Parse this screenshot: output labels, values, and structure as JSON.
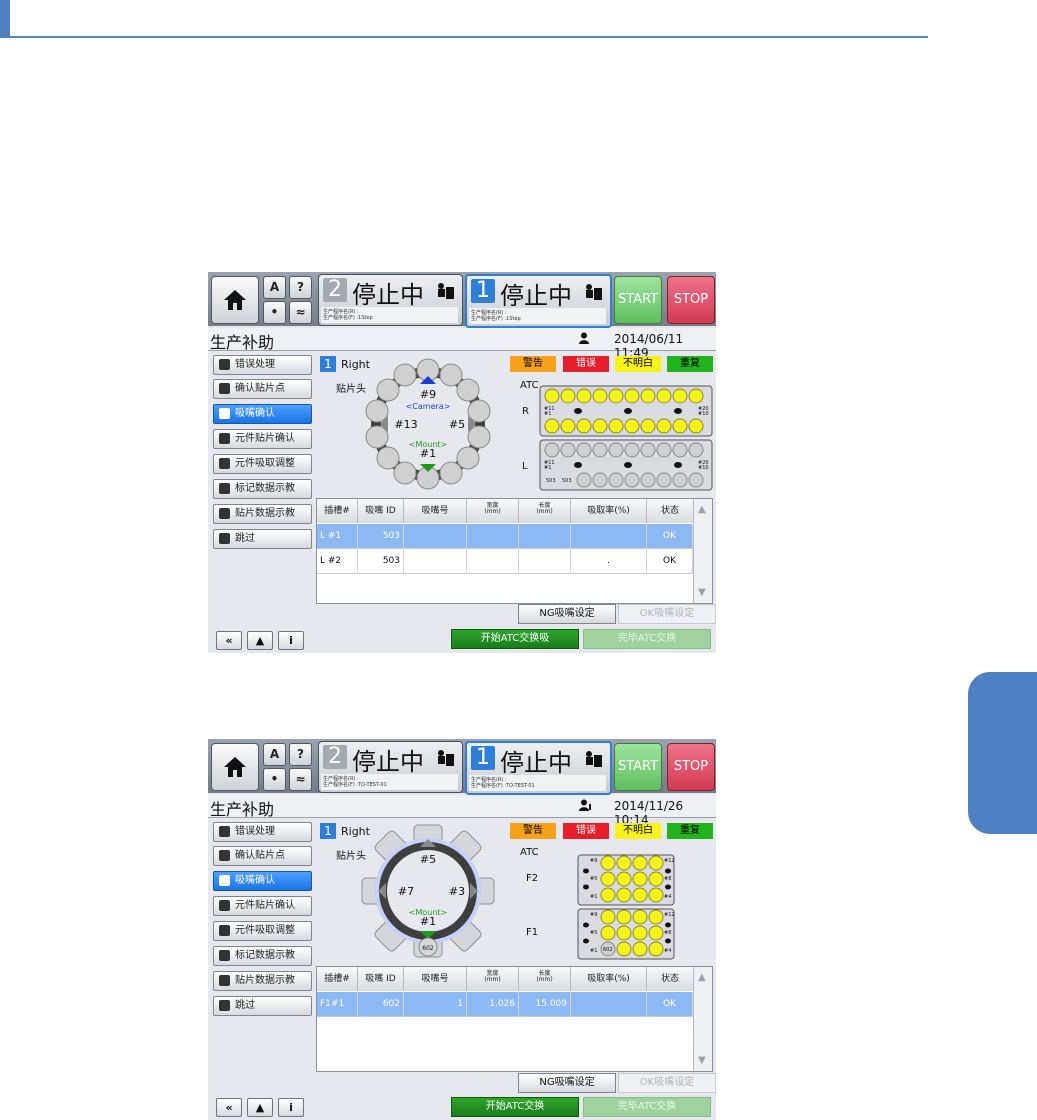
{
  "screens": [
    {
      "lane2": {
        "number": "2",
        "status": "停止中",
        "info": [
          "生产程序名(R) :",
          "生产程序名(F) :1Step"
        ]
      },
      "lane1": {
        "number": "1",
        "status": "停止中",
        "info": [
          "生产程序名(R) :",
          "生产程序名(F) :1Step"
        ]
      },
      "start_label": "START",
      "stop_label": "STOP",
      "title": "生产补助",
      "datetime": "2014/06/11 11:49",
      "menu": [
        "错误处理",
        "确认贴片点",
        "吸嘴确认",
        "元件贴片确认",
        "元件吸取调整",
        "标记数据示教",
        "贴片数据示教",
        "跳过"
      ],
      "head": {
        "number": "1",
        "name": "Right",
        "label": "贴片头",
        "top": "#9",
        "camera": "<Camera>",
        "left": "#13",
        "right": "#5",
        "mount": "<Mount>",
        "bottom": "#1"
      },
      "legend": [
        "警告",
        "错误",
        "不明白",
        "重复"
      ],
      "atc": {
        "title": "ATC",
        "r": "R",
        "l": "L",
        "r_marks": [
          "#11",
          "#1",
          "#20",
          "#10"
        ],
        "l_marks": [
          "#11",
          "#1",
          "#20",
          "#10"
        ],
        "l_ids": [
          "503",
          "503"
        ]
      },
      "table": {
        "headers": [
          "插槽#",
          "吸嘴 ID",
          "吸嘴号",
          "宽度",
          "长度",
          "吸取率(%)",
          "状态"
        ],
        "units": [
          "",
          "",
          "",
          "(mm)",
          "(mm)",
          "",
          ""
        ],
        "rows": [
          [
            "L #1",
            "503",
            "",
            "",
            "",
            "",
            "OK"
          ],
          [
            "L #2",
            "503",
            "",
            "",
            "",
            ".",
            "OK"
          ]
        ]
      },
      "buttons": {
        "ng": "NG吸嘴设定",
        "ok": "OK吸嘴设定",
        "start_atc": "开始ATC交换吸",
        "finish_atc": "完毕ATC交换"
      }
    },
    {
      "lane2": {
        "number": "2",
        "status": "停止中",
        "info": [
          "生产程序名(R) :",
          "生产程序名(F) :TO-TEST-01"
        ]
      },
      "lane1": {
        "number": "1",
        "status": "停止中",
        "info": [
          "生产程序名(R) :",
          "生产程序名(F) :TO-TEST-01"
        ]
      },
      "start_label": "START",
      "stop_label": "STOP",
      "title": "生产补助",
      "datetime": "2014/11/26 10:14",
      "menu": [
        "错误处理",
        "确认贴片点",
        "吸嘴确认",
        "元件贴片确认",
        "元件吸取调整",
        "标记数据示教",
        "贴片数据示教",
        "跳过"
      ],
      "head": {
        "number": "1",
        "name": "Right",
        "label": "贴片头",
        "top": "#5",
        "left": "#7",
        "right": "#3",
        "mount": "<Mount>",
        "bottom": "#1",
        "nozzle_id": "602"
      },
      "legend": [
        "警告",
        "错误",
        "不明白",
        "重复"
      ],
      "atc": {
        "title": "ATC",
        "f2": "F2",
        "f1": "F1",
        "f2_marks": [
          "#9",
          "#12",
          "#5",
          "#8",
          "#1",
          "#4"
        ],
        "f1_marks": [
          "#9",
          "#12",
          "#5",
          "#8",
          "#1",
          "#4"
        ],
        "f1_id": "602"
      },
      "table": {
        "headers": [
          "插槽#",
          "吸嘴 ID",
          "吸嘴号",
          "宽度",
          "长度",
          "吸取率(%)",
          "状态"
        ],
        "units": [
          "",
          "",
          "",
          "(mm)",
          "(mm)",
          "",
          ""
        ],
        "rows": [
          [
            "F1#1",
            "602",
            "1",
            "1.026",
            "15.009",
            "",
            "OK"
          ]
        ]
      },
      "buttons": {
        "ng": "NG吸嘴设定",
        "ok": "OK吸嘴设定",
        "start_atc": "开始ATC交换",
        "finish_atc": "完毕ATC交换"
      }
    }
  ],
  "colors": {
    "accent": "#2f7fd6",
    "warning": "#f7a21b",
    "error": "#e71d2a",
    "unknown": "#f6f31b",
    "repeat": "#22b31f",
    "page_rule": "#5b86c4"
  }
}
